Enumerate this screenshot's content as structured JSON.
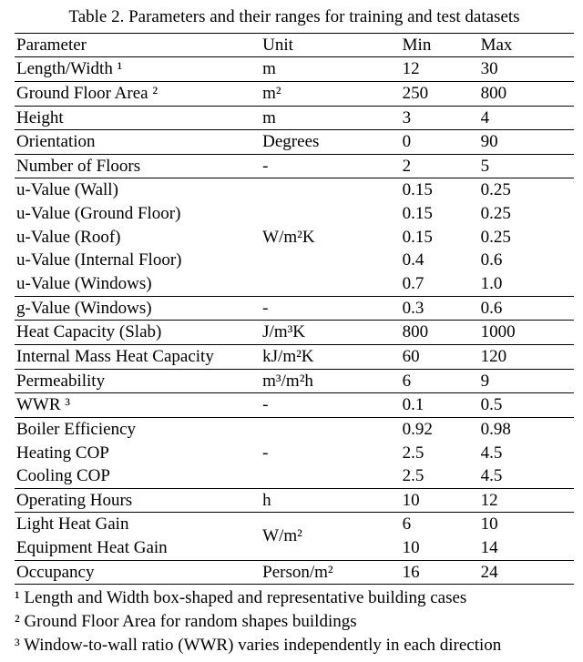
{
  "caption": "Table 2.    Parameters and their ranges for training and test datasets",
  "header": {
    "parameter": "Parameter",
    "unit": "Unit",
    "min": "Min",
    "max": "Max"
  },
  "rows": {
    "lengthWidth": {
      "parameter": "Length/Width ¹",
      "unit": "m",
      "min": "12",
      "max": "30"
    },
    "gfa": {
      "parameter": "Ground Floor Area ²",
      "unit": "m²",
      "min": "250",
      "max": "800"
    },
    "height": {
      "parameter": "Height",
      "unit": "m",
      "min": "3",
      "max": "4"
    },
    "orientation": {
      "parameter": "Orientation",
      "unit": "Degrees",
      "min": "0",
      "max": "90"
    },
    "numFloors": {
      "parameter": "Number of Floors",
      "unit": "-",
      "min": "2",
      "max": "5"
    },
    "uWall": {
      "parameter": "u-Value (Wall)",
      "min": "0.15",
      "max": "0.25"
    },
    "uGround": {
      "parameter": "u-Value (Ground Floor)",
      "min": "0.15",
      "max": "0.25"
    },
    "uRoof": {
      "parameter": "u-Value (Roof)",
      "unit": "W/m²K",
      "min": "0.15",
      "max": "0.25"
    },
    "uIntFloor": {
      "parameter": "u-Value (Internal Floor)",
      "min": "0.4",
      "max": "0.6"
    },
    "uWindows": {
      "parameter": "u-Value (Windows)",
      "min": "0.7",
      "max": "1.0"
    },
    "gWindows": {
      "parameter": "g-Value (Windows)",
      "unit": "-",
      "min": "0.3",
      "max": "0.6"
    },
    "heatCapSlab": {
      "parameter": "Heat Capacity (Slab)",
      "unit": "J/m³K",
      "min": "800",
      "max": "1000"
    },
    "intMassHC": {
      "parameter": "Internal Mass Heat Capacity",
      "unit": "kJ/m²K",
      "min": "60",
      "max": "120"
    },
    "permeability": {
      "parameter": "Permeability",
      "unit": "m³/m²h",
      "min": "6",
      "max": "9"
    },
    "wwr": {
      "parameter": "WWR ³",
      "unit": "-",
      "min": "0.1",
      "max": "0.5"
    },
    "boilerEff": {
      "parameter": "Boiler Efficiency",
      "min": "0.92",
      "max": "0.98"
    },
    "heatCOP": {
      "parameter": "Heating COP",
      "unit": "-",
      "min": "2.5",
      "max": "4.5"
    },
    "coolCOP": {
      "parameter": "Cooling COP",
      "min": "2.5",
      "max": "4.5"
    },
    "opHours": {
      "parameter": "Operating Hours",
      "unit": "h",
      "min": "10",
      "max": "12"
    },
    "lightGain": {
      "parameter": "Light Heat Gain",
      "unit": "W/m²",
      "min": "6",
      "max": "10"
    },
    "equipGain": {
      "parameter": "Equipment Heat Gain",
      "min": "10",
      "max": "14"
    },
    "occupancy": {
      "parameter": "Occupancy",
      "unit": "Person/m²",
      "min": "16",
      "max": "24"
    }
  },
  "footnotes": {
    "f1": "¹ Length and Width box-shaped and representative building cases",
    "f2": "² Ground Floor Area for random shapes buildings",
    "f3": "³ Window-to-wall ratio (WWR) varies independently in each direction"
  },
  "chart_data": {
    "type": "table",
    "title": "Parameters and their ranges for training and test datasets",
    "columns": [
      "Parameter",
      "Unit",
      "Min",
      "Max"
    ],
    "rows": [
      [
        "Length/Width",
        "m",
        12,
        30
      ],
      [
        "Ground Floor Area",
        "m²",
        250,
        800
      ],
      [
        "Height",
        "m",
        3,
        4
      ],
      [
        "Orientation",
        "Degrees",
        0,
        90
      ],
      [
        "Number of Floors",
        "-",
        2,
        5
      ],
      [
        "u-Value (Wall)",
        "W/m²K",
        0.15,
        0.25
      ],
      [
        "u-Value (Ground Floor)",
        "W/m²K",
        0.15,
        0.25
      ],
      [
        "u-Value (Roof)",
        "W/m²K",
        0.15,
        0.25
      ],
      [
        "u-Value (Internal Floor)",
        "W/m²K",
        0.4,
        0.6
      ],
      [
        "u-Value (Windows)",
        "W/m²K",
        0.7,
        1.0
      ],
      [
        "g-Value (Windows)",
        "-",
        0.3,
        0.6
      ],
      [
        "Heat Capacity (Slab)",
        "J/m³K",
        800,
        1000
      ],
      [
        "Internal Mass Heat Capacity",
        "kJ/m²K",
        60,
        120
      ],
      [
        "Permeability",
        "m³/m²h",
        6,
        9
      ],
      [
        "WWR",
        "-",
        0.1,
        0.5
      ],
      [
        "Boiler Efficiency",
        "-",
        0.92,
        0.98
      ],
      [
        "Heating COP",
        "-",
        2.5,
        4.5
      ],
      [
        "Cooling COP",
        "-",
        2.5,
        4.5
      ],
      [
        "Operating Hours",
        "h",
        10,
        12
      ],
      [
        "Light Heat Gain",
        "W/m²",
        6,
        10
      ],
      [
        "Equipment Heat Gain",
        "W/m²",
        10,
        14
      ],
      [
        "Occupancy",
        "Person/m²",
        16,
        24
      ]
    ],
    "footnotes": [
      "Length and Width box-shaped and representative building cases",
      "Ground Floor Area for random shapes buildings",
      "Window-to-wall ratio (WWR) varies independently in each direction"
    ]
  }
}
